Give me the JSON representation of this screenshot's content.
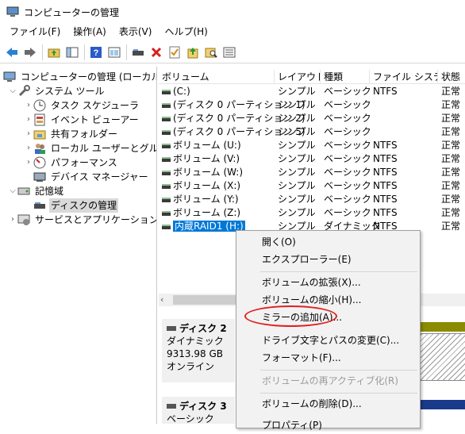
{
  "window": {
    "title": "コンピューターの管理"
  },
  "menu": [
    "ファイル(F)",
    "操作(A)",
    "表示(V)",
    "ヘルプ(H)"
  ],
  "toolbar": {
    "icons": [
      "back-arrow-icon",
      "forward-arrow-icon",
      "up-folder-icon",
      "show-hide-tree-icon",
      "help-icon",
      "properties-icon",
      "connect-drive-icon",
      "delete-icon",
      "check-icon",
      "folder-up-icon",
      "search-folder-icon",
      "list-view-icon"
    ]
  },
  "tree": {
    "root": "コンピューターの管理 (ローカル)",
    "system_tools": "システム ツール",
    "task_scheduler": "タスク スケジューラ",
    "event_viewer": "イベント ビューアー",
    "shared_folders": "共有フォルダー",
    "local_users": "ローカル ユーザーとグループ",
    "performance": "パフォーマンス",
    "device_manager": "デバイス マネージャー",
    "storage": "記憶域",
    "disk_management": "ディスクの管理",
    "services_apps": "サービスとアプリケーション"
  },
  "volumes": {
    "columns": [
      "ボリューム",
      "レイアウト",
      "種類",
      "ファイル システム",
      "状態"
    ],
    "rows": [
      {
        "name": "(C:)",
        "layout": "シンプル",
        "type": "ベーシック",
        "fs": "NTFS",
        "status": "正常"
      },
      {
        "name": "(ディスク 0 パーティション 1)",
        "layout": "シンプル",
        "type": "ベーシック",
        "fs": "",
        "status": "正常"
      },
      {
        "name": "(ディスク 0 パーティション 2)",
        "layout": "シンプル",
        "type": "ベーシック",
        "fs": "",
        "status": "正常"
      },
      {
        "name": "(ディスク 0 パーティション 5)",
        "layout": "シンプル",
        "type": "ベーシック",
        "fs": "",
        "status": "正常"
      },
      {
        "name": "ボリューム (U:)",
        "layout": "シンプル",
        "type": "ベーシック",
        "fs": "NTFS",
        "status": "正常"
      },
      {
        "name": "ボリューム (V:)",
        "layout": "シンプル",
        "type": "ベーシック",
        "fs": "NTFS",
        "status": "正常"
      },
      {
        "name": "ボリューム (W:)",
        "layout": "シンプル",
        "type": "ベーシック",
        "fs": "NTFS",
        "status": "正常"
      },
      {
        "name": "ボリューム (X:)",
        "layout": "シンプル",
        "type": "ベーシック",
        "fs": "NTFS",
        "status": "正常"
      },
      {
        "name": "ボリューム (Y:)",
        "layout": "シンプル",
        "type": "ベーシック",
        "fs": "NTFS",
        "status": "正常"
      },
      {
        "name": "ボリューム (Z:)",
        "layout": "シンプル",
        "type": "ベーシック",
        "fs": "NTFS",
        "status": "正常"
      },
      {
        "name": "内蔵RAID1 (H:)",
        "layout": "シンプル",
        "type": "ダイナミック",
        "fs": "NTFS",
        "status": "正常"
      }
    ]
  },
  "disks": [
    {
      "name": "ディスク 2",
      "type": "ダイナミック",
      "size": "9313.98 GB",
      "state": "オンライン"
    },
    {
      "name": "ディスク 3",
      "type": "ベーシック"
    }
  ],
  "context_menu": {
    "items": [
      {
        "label": "開く(O)",
        "disabled": false
      },
      {
        "label": "エクスプローラー(E)",
        "disabled": false
      },
      {
        "label": "ボリュームの拡張(X)...",
        "disabled": false
      },
      {
        "label": "ボリュームの縮小(H)...",
        "disabled": false
      },
      {
        "label": "ミラーの追加(A)...",
        "disabled": false
      },
      {
        "label": "ドライブ文字とパスの変更(C)...",
        "disabled": false
      },
      {
        "label": "フォーマット(F)...",
        "disabled": false
      },
      {
        "label": "ボリュームの再アクティブ化(R)",
        "disabled": true
      },
      {
        "label": "ボリュームの削除(D)...",
        "disabled": false
      },
      {
        "label": "プロパティ(P)",
        "disabled": false
      }
    ]
  },
  "colors": {
    "selection": "#0078d7",
    "annotation": "#e02020",
    "volume_bar": "#8b8b00",
    "volume_bar2": "#1a3a8a"
  }
}
